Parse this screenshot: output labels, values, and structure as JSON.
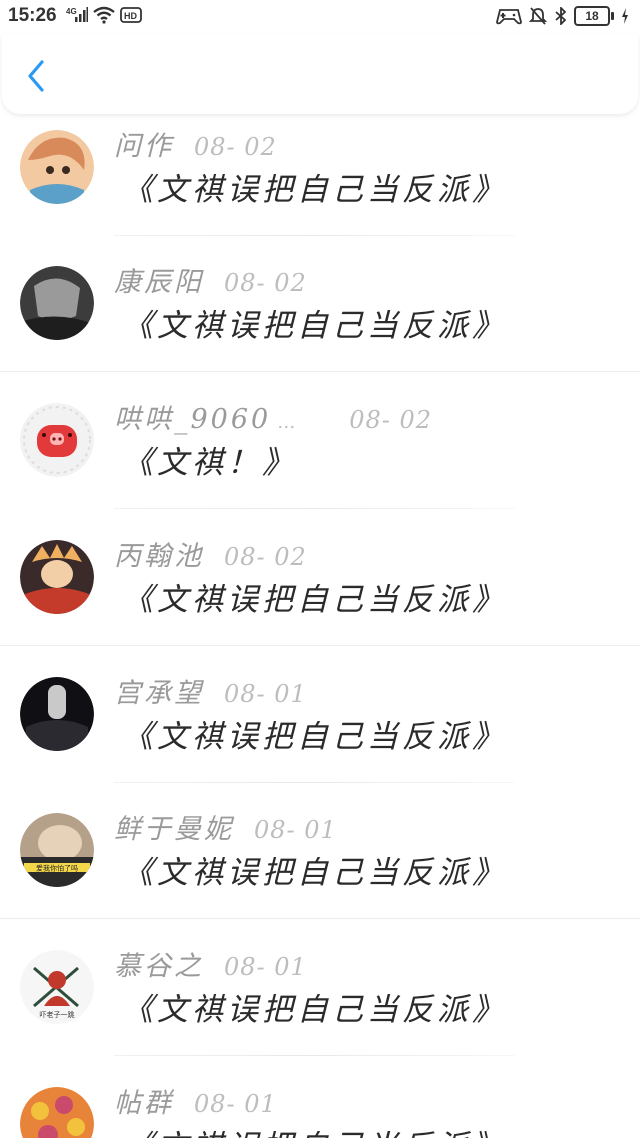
{
  "status_bar": {
    "time": "15:26",
    "network": "4G",
    "hd": "HD",
    "battery": "18"
  },
  "comments": [
    {
      "username": "问作",
      "date": "08- 02",
      "text": "《文祺误把自己当反派》",
      "avatar_colors": [
        "#d98a5a",
        "#f2c9a0",
        "#5aa0c8"
      ]
    },
    {
      "username": "康辰阳",
      "date": "08- 02",
      "text": "《文祺误把自己当反派》",
      "avatar_colors": [
        "#3c3c3c",
        "#9a9a9a",
        "#1e1e1e"
      ]
    },
    {
      "username": "哄哄_9060",
      "ellipsis": "…",
      "date": "08- 02",
      "text": "《文祺！》",
      "avatar_colors": [
        "#f2f2f2",
        "#e23a3a",
        "#dddddd"
      ]
    },
    {
      "username": "丙翰池",
      "date": "08- 02",
      "text": "《文祺误把自己当反派》",
      "avatar_colors": [
        "#c43b2b",
        "#f0b060",
        "#3a2a2a"
      ]
    },
    {
      "username": "宫承望",
      "date": "08- 01",
      "text": "《文祺误把自己当反派》",
      "avatar_colors": [
        "#101014",
        "#c9c9c9",
        "#2a2a30"
      ]
    },
    {
      "username": "鲜于曼妮",
      "date": "08- 01",
      "text": "《文祺误把自己当反派》",
      "avatar_colors": [
        "#b5a08a",
        "#e6d2b8",
        "#2b2b2b"
      ],
      "avatar_caption": "爱我你怕了吗"
    },
    {
      "username": "慕谷之",
      "date": "08- 01",
      "text": "《文祺误把自己当反派》",
      "avatar_colors": [
        "#f6f6f6",
        "#c0392b",
        "#2e4d3a"
      ],
      "avatar_caption": "吓老子一跳"
    },
    {
      "username": "帖群",
      "date": "08- 01",
      "text": "《文祺误把自己当反派》",
      "avatar_colors": [
        "#e8833a",
        "#f3c23c",
        "#c94a6a"
      ]
    }
  ]
}
